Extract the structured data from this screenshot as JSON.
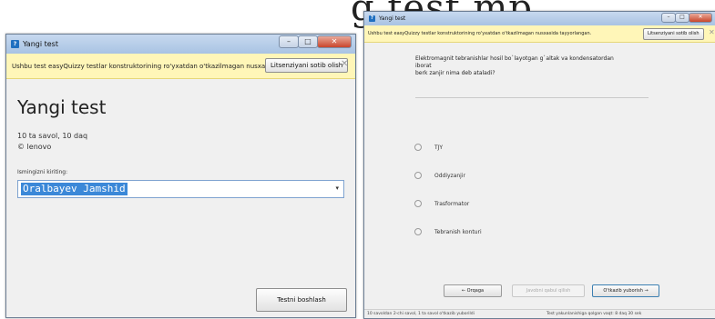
{
  "background_text": "g  test  mp",
  "left_window": {
    "title": "Yangi test",
    "icon": "question-mark-icon",
    "controls": [
      "–",
      "□",
      "✕"
    ],
    "infobar": {
      "text": "Ushbu test easyQuizzy testlar konstruktorining ro'yxatdan o'tkazilmagan nusxasida tayyorlangan.",
      "license_button": "Litsenziyani sotib olish",
      "close": "✕"
    },
    "test_title": "Yangi test",
    "meta_line1": "10 ta savol, 10 daq",
    "meta_line2": "© lenovo",
    "name_label": "Ismingizni kiriting:",
    "name_value": "Oralbayev Jamshid",
    "dropdown_caret": "▾",
    "start_button": "Testni boshlash"
  },
  "right_window": {
    "title": "Yangi test",
    "icon": "question-mark-icon",
    "controls": [
      "–",
      "□",
      "✕"
    ],
    "infobar": {
      "text": "Ushbu test easyQuizzy testlar konstruktorining ro'yxatdan o'tkazilmagan nusxasida tayyorlangan.",
      "license_button": "Litsenziyani sotib olish",
      "close": "✕"
    },
    "question_line1": "Elektromagnit tebranishlar hosil bo`layotgan g`altak va kondensatordan",
    "question_line2": "iborat",
    "question_line3": "berk zanjir nima deb ataladi?",
    "answers": [
      "TJY",
      "Oddiyzanjir",
      "Trasformator",
      "Tebranish konturi"
    ],
    "nav": {
      "back": "← Orqaga",
      "accept": "Javobni qabul qilish",
      "skip": "O'tkazib yuborish →"
    },
    "status": {
      "left": "10 savoldan 2-chi savol, 1 ta savol o'tkazib yuborildi",
      "right": "Test yakunlanishiga qolgan vaqt: 8 daq 30 sek"
    }
  }
}
